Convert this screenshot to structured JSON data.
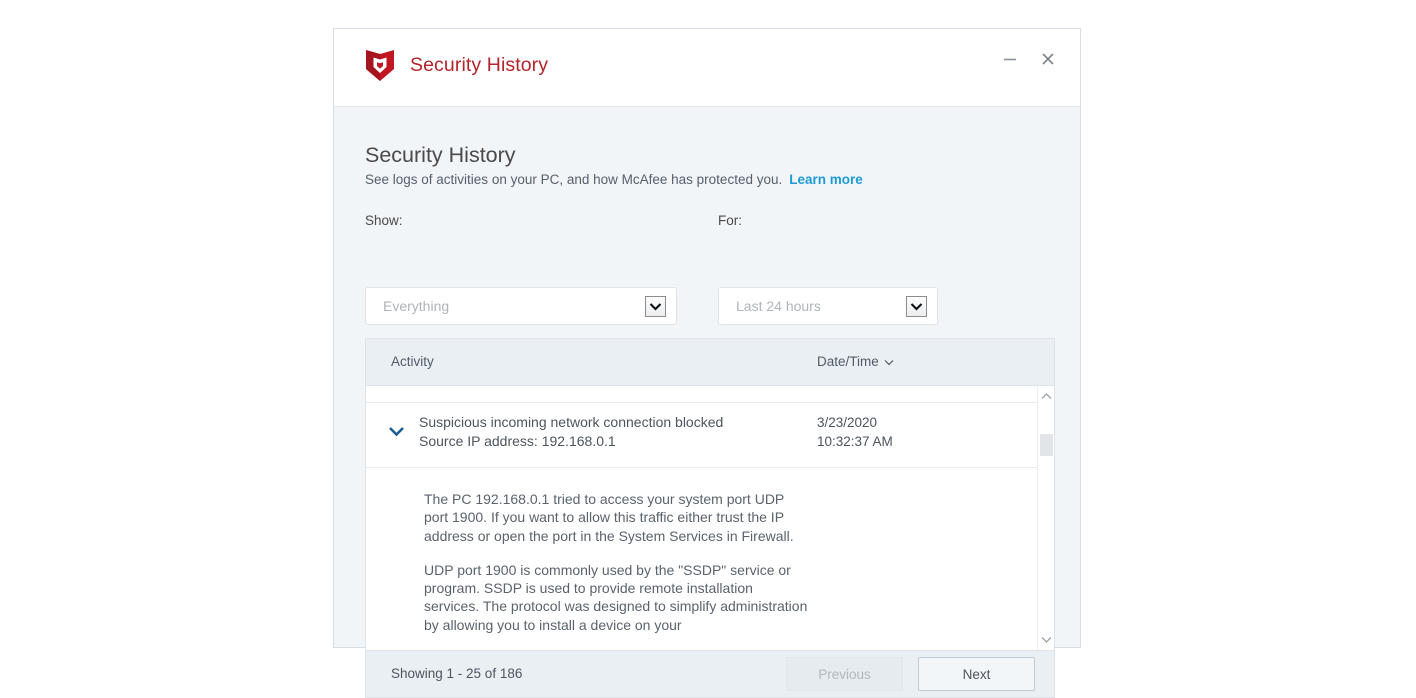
{
  "window": {
    "brand_title": "Security History",
    "minimize_label": "minimize",
    "close_label": "close"
  },
  "header": {
    "page_title": "Security History",
    "subtitle": "See logs of activities on your PC, and how McAfee has protected you.",
    "learn_more": "Learn more"
  },
  "filters": {
    "show_label": "Show:",
    "show_value": "Everything",
    "for_label": "For:",
    "for_value": "Last 24 hours"
  },
  "table": {
    "columns": {
      "activity": "Activity",
      "datetime": "Date/Time"
    },
    "row": {
      "activity": "Suspicious incoming network connection blocked",
      "source": "Source IP address: 192.168.0.1",
      "date": "3/23/2020",
      "time": "10:32:37 AM",
      "detail_p1": "The PC 192.168.0.1 tried to access your system port UDP port 1900. If you want to allow this traffic either trust the IP address or open the port in the System Services in Firewall.",
      "detail_p2": "UDP port 1900 is commonly used by the \"SSDP\" service or program. SSDP is used to provide remote installation services. The protocol was designed to simplify administration by allowing you to install a device on your"
    }
  },
  "footer": {
    "showing": "Showing 1 - 25 of 186",
    "previous": "Previous",
    "next": "Next"
  },
  "colors": {
    "brand_red": "#b4242a",
    "link_blue": "#1e9ad6",
    "caret_blue": "#1d5f93"
  }
}
